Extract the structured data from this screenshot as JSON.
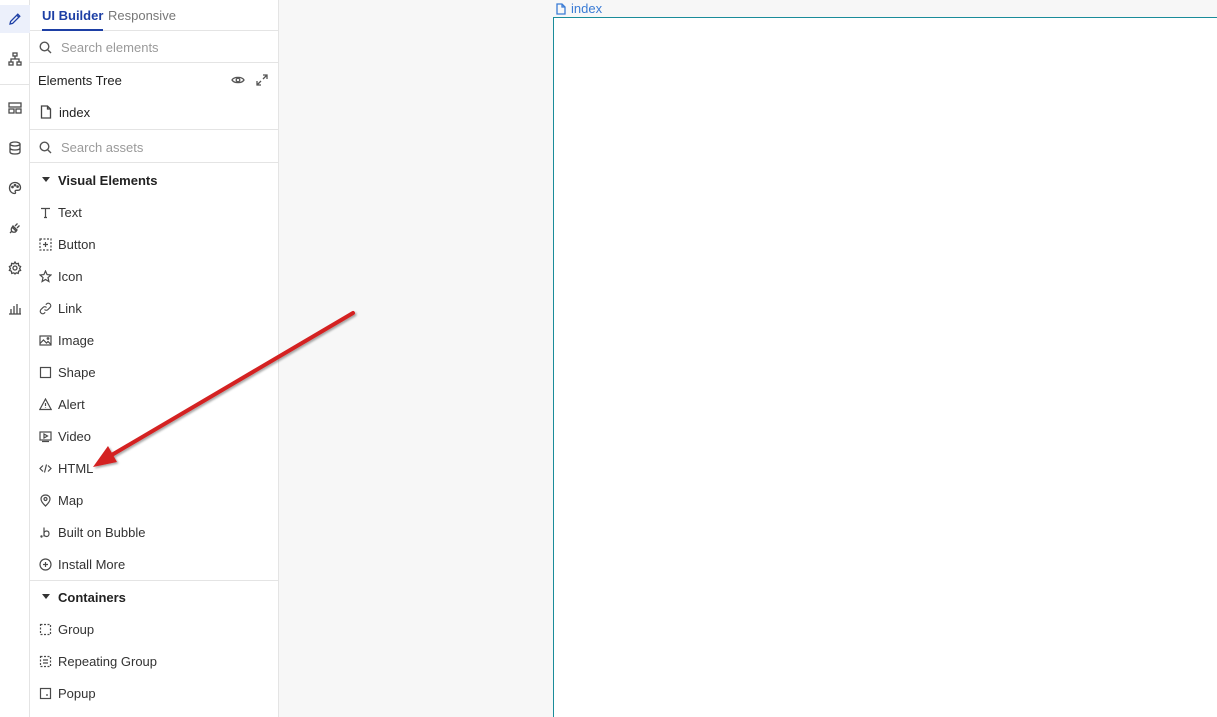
{
  "tabs": {
    "active": "UI Builder",
    "inactive": "Responsive"
  },
  "search_elements": {
    "placeholder": "Search elements"
  },
  "elements_tree": {
    "title": "Elements Tree",
    "index_label": "index"
  },
  "search_assets": {
    "placeholder": "Search assets"
  },
  "visual_elements": {
    "title": "Visual Elements",
    "items": [
      {
        "label": "Text",
        "icon": "text-icon"
      },
      {
        "label": "Button",
        "icon": "button-icon"
      },
      {
        "label": "Icon",
        "icon": "star-icon"
      },
      {
        "label": "Link",
        "icon": "link-icon"
      },
      {
        "label": "Image",
        "icon": "image-icon"
      },
      {
        "label": "Shape",
        "icon": "square-icon"
      },
      {
        "label": "Alert",
        "icon": "warning-icon"
      },
      {
        "label": "Video",
        "icon": "video-icon"
      },
      {
        "label": "HTML",
        "icon": "code-icon"
      },
      {
        "label": "Map",
        "icon": "map-pin-icon"
      },
      {
        "label": "Built on Bubble",
        "icon": "bubble-logo-icon"
      },
      {
        "label": "Install More",
        "icon": "plus-circle-icon"
      }
    ]
  },
  "containers": {
    "title": "Containers",
    "items": [
      {
        "label": "Group",
        "icon": "dashed-square-icon"
      },
      {
        "label": "Repeating Group",
        "icon": "repeating-group-icon"
      },
      {
        "label": "Popup",
        "icon": "popup-icon"
      }
    ]
  },
  "canvas": {
    "page_tab": "index"
  },
  "colors": {
    "accent": "#1d3fa5",
    "page_border": "#1a8c9a",
    "arrow": "#d42020"
  }
}
